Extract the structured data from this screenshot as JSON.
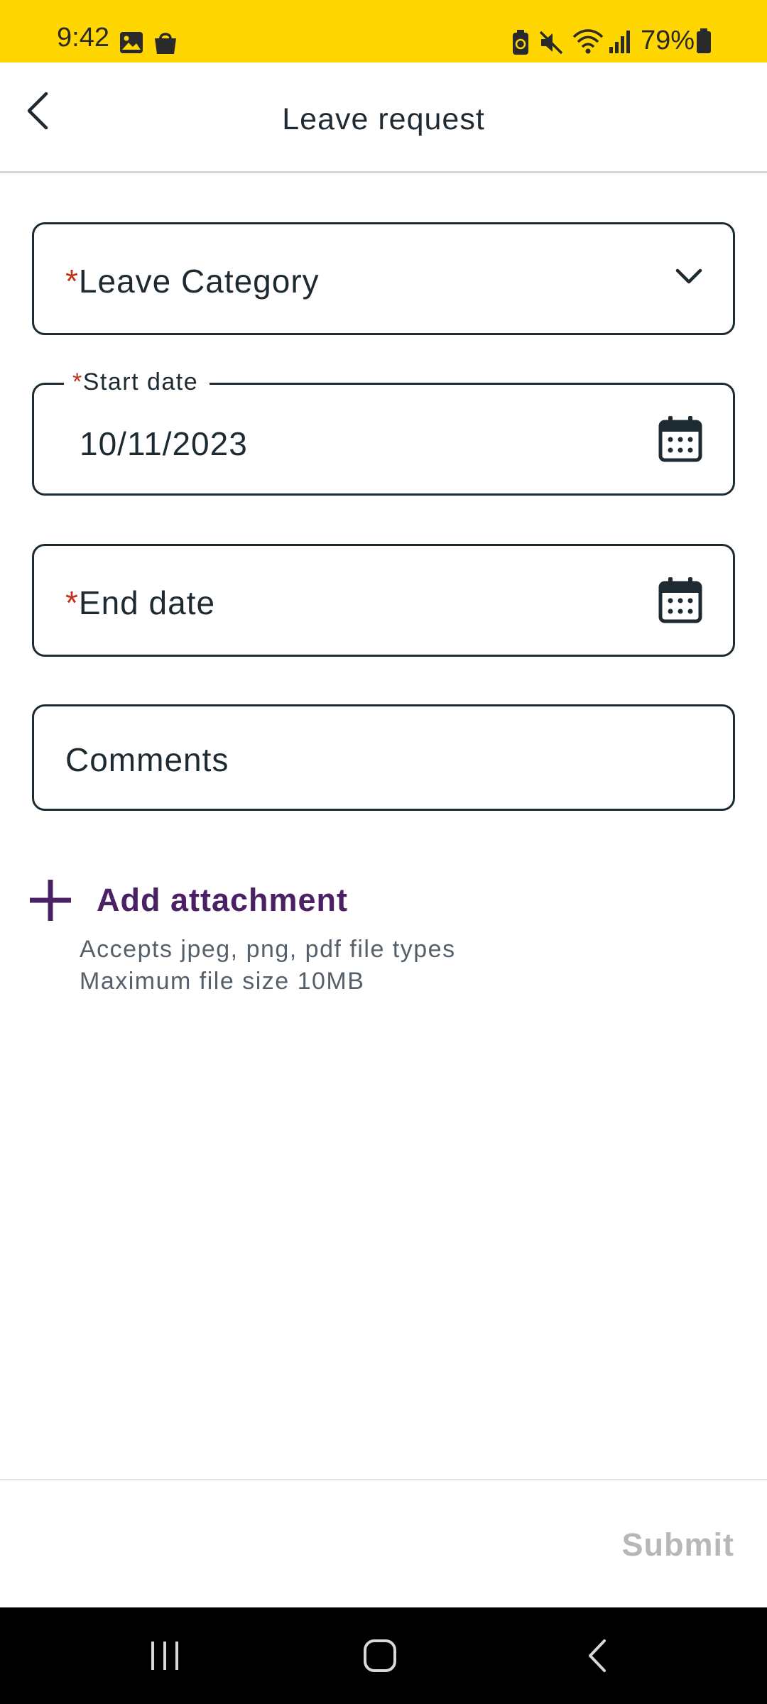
{
  "status_bar": {
    "time": "9:42",
    "battery": "79%",
    "icons": [
      "image-icon",
      "shopping-bag-icon",
      "battery-saver-icon",
      "mute-icon",
      "wifi-icon",
      "signal-icon",
      "battery-icon"
    ]
  },
  "header": {
    "title": "Leave request",
    "back_icon": "chevron-left-icon"
  },
  "form": {
    "leave_category": {
      "required_mark": "*",
      "label": "Leave Category",
      "icon": "chevron-down-icon"
    },
    "start_date": {
      "required_mark": "*",
      "label": "Start date",
      "value": "10/11/2023",
      "icon": "calendar-icon"
    },
    "end_date": {
      "required_mark": "*",
      "label": "End date",
      "icon": "calendar-icon"
    },
    "comments": {
      "label": "Comments"
    }
  },
  "attachment": {
    "label": "Add attachment",
    "hint_types": "Accepts jpeg, png, pdf file types",
    "hint_size": "Maximum file size 10MB"
  },
  "footer": {
    "submit_label": "Submit"
  },
  "colors": {
    "status_bar": "#ffd600",
    "accent": "#4a2164",
    "required": "#c0321c",
    "border": "#1d2a32",
    "disabled": "#b7b7b7"
  }
}
